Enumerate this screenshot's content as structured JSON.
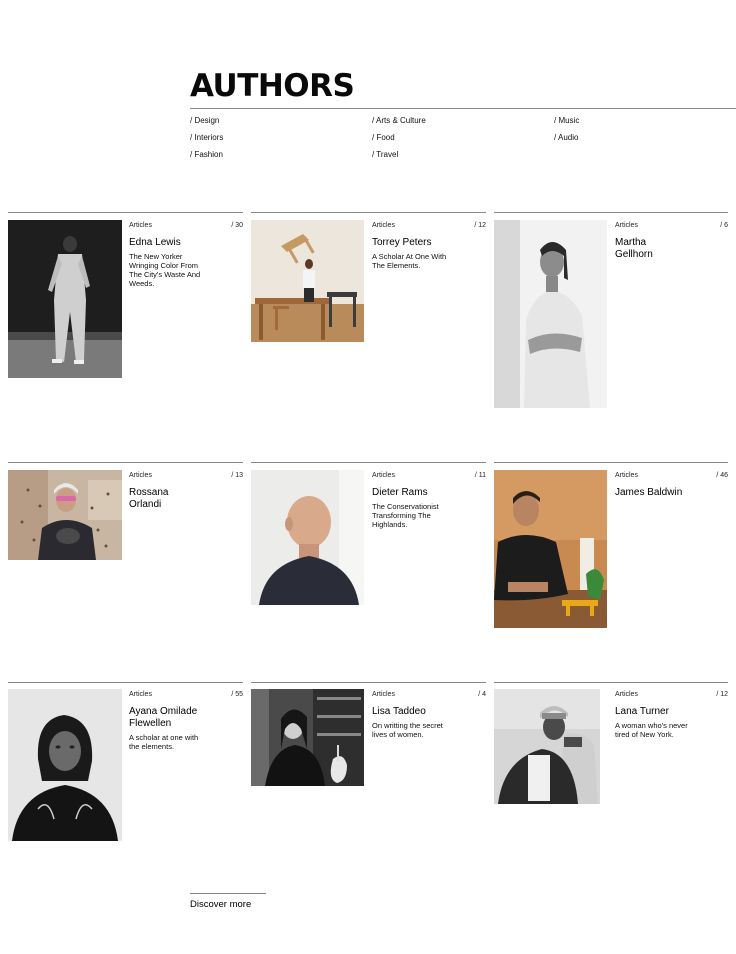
{
  "page": {
    "title": "AUTHORS",
    "categories": [
      {
        "label": "/ Design"
      },
      {
        "label": "/ Interiors"
      },
      {
        "label": "/ Fashion"
      },
      {
        "label": "/ Arts & Culture"
      },
      {
        "label": "/ Food"
      },
      {
        "label": "/ Travel"
      },
      {
        "label": "/ Music"
      },
      {
        "label": "/ Audio"
      }
    ],
    "authors": [
      {
        "name": "Edna Lewis",
        "label": "Articles",
        "count": "/ 30",
        "description": "The New Yorker Wringing Color From The City's Waste And Weeds."
      },
      {
        "name": "Torrey Peters",
        "label": "Articles",
        "count": "/ 12",
        "description": "A Scholar At One With The Elements."
      },
      {
        "name": "Martha Gellhorn",
        "label": "Articles",
        "count": "/ 6",
        "description": ""
      },
      {
        "name": "Rossana Orlandi",
        "label": "Articles",
        "count": "/ 13",
        "description": ""
      },
      {
        "name": "Dieter Rams",
        "label": "Articles",
        "count": "/ 11",
        "description": "The Conservationist Transforming The Highlands."
      },
      {
        "name": "James Baldwin",
        "label": "Articles",
        "count": "/ 46",
        "description": ""
      },
      {
        "name": "Ayana Omilade Flewellen",
        "label": "Articles",
        "count": "/ 55",
        "description": "A scholar at one with the elements."
      },
      {
        "name": "Lisa Taddeo",
        "label": "Articles",
        "count": "/ 4",
        "description": "On writting the secret lives of women."
      },
      {
        "name": "Lana Turner",
        "label": "Articles",
        "count": "/ 12",
        "description": "A woman who's never tired of New York."
      }
    ],
    "discover_label": "Discover more"
  }
}
